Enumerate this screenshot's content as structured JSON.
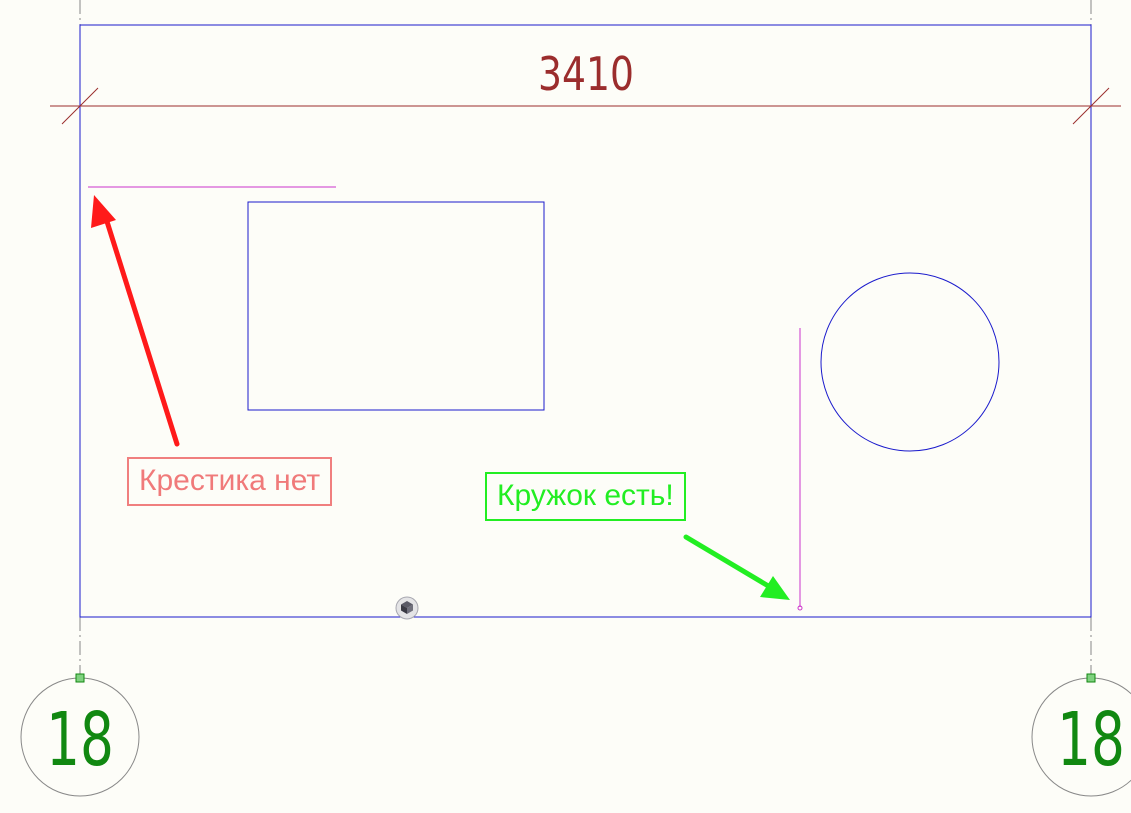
{
  "drawing": {
    "dimension_label": "3410",
    "axis_marker_left": "18",
    "axis_marker_right": "18"
  },
  "annotations": {
    "no_cross": {
      "text": "Крестика нет",
      "color": "#f07a7a"
    },
    "has_circle": {
      "text": "Кружок есть!",
      "color": "#22ee22"
    }
  },
  "colors": {
    "background": "#fdfdf8",
    "outline_blue": "#1a1acc",
    "dimension_red": "#9b2d2d",
    "magenta": "#cc33cc",
    "axis_green": "#118811",
    "axis_gray": "#888888",
    "arrow_red": "#ff1a1a",
    "arrow_green": "#22ee22"
  }
}
